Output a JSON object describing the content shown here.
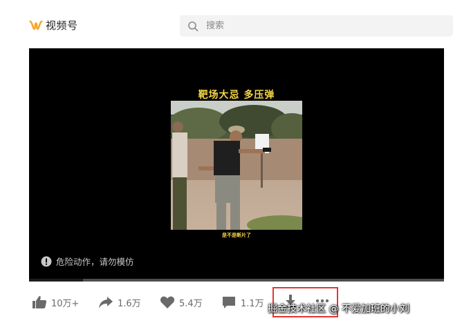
{
  "app": {
    "name": "视频号"
  },
  "search": {
    "placeholder": "搜索",
    "value": ""
  },
  "video": {
    "title_caption": "靶场大忌  多压弹",
    "subtitle_caption": "是不是断片了",
    "warning_text": "危险动作，请勿模仿",
    "progress": {
      "played_fraction": 0.13,
      "buffered_fraction": 0.13
    }
  },
  "actions": {
    "like_count": "10万+",
    "share_count": "1.6万",
    "favorite_count": "5.4万",
    "comment_count": "1.1万"
  },
  "watermark": "掘金技术社区 @ 不爱加班的小刘",
  "icons": {
    "logo": "video-channel-logo-icon",
    "search": "search-icon",
    "warning": "warning-icon",
    "like": "thumbs-up-icon",
    "share": "share-arrow-icon",
    "favorite": "heart-icon",
    "comment": "comment-icon",
    "download": "download-icon",
    "more": "more-dots-icon"
  },
  "colors": {
    "accent_logo": "#f5a623",
    "caption_yellow": "#f5d547",
    "highlight_red": "#e63333"
  }
}
